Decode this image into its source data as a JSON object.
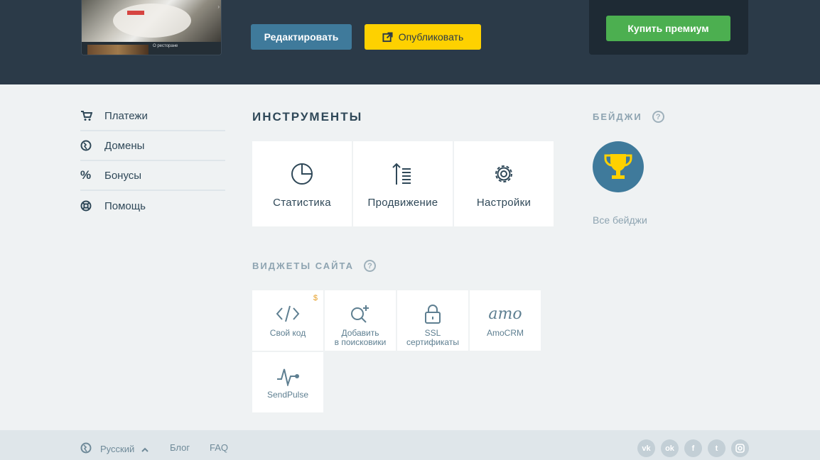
{
  "header": {
    "preview_caption": "О ресторане",
    "edit_button": "Редактировать",
    "publish_button": "Опубликовать",
    "premium_button": "Купить премиум"
  },
  "sidebar": {
    "items": [
      {
        "label": "Платежи",
        "icon": "cart-icon"
      },
      {
        "label": "Домены",
        "icon": "globe-icon"
      },
      {
        "label": "Бонусы",
        "icon": "percent-icon"
      },
      {
        "label": "Помощь",
        "icon": "lifebuoy-icon"
      }
    ]
  },
  "tools": {
    "title": "ИНСТРУМЕНТЫ",
    "items": [
      {
        "label": "Статистика",
        "icon": "pie-chart-icon"
      },
      {
        "label": "Продвижение",
        "icon": "promotion-icon"
      },
      {
        "label": "Настройки",
        "icon": "gear-icon"
      }
    ]
  },
  "widgets": {
    "title": "ВИДЖЕТЫ САЙТА",
    "help": "?",
    "items": [
      {
        "label": "Свой код",
        "icon": "code-icon",
        "paid_mark": "$"
      },
      {
        "label_line1": "Добавить",
        "label_line2": "в поисковики",
        "icon": "search-add-icon"
      },
      {
        "label_line1": "SSL",
        "label_line2": "сертификаты",
        "icon": "lock-icon"
      },
      {
        "label": "AmoCRM",
        "icon": "amo-logo",
        "logo_text": "amo"
      },
      {
        "label": "SendPulse",
        "icon": "pulse-icon"
      }
    ]
  },
  "badges": {
    "title": "БЕЙДЖИ",
    "help": "?",
    "all_link": "Все бейджи",
    "badge_icon": "trophy-icon"
  },
  "footer": {
    "language": "Русский",
    "blog": "Блог",
    "faq": "FAQ",
    "socials": [
      "vk",
      "ok",
      "f",
      "t",
      "ig"
    ]
  },
  "colors": {
    "header_bg": "#2b3a48",
    "edit_button": "#3f7a9b",
    "publish_button": "#fed100",
    "premium_button": "#4caf50",
    "accent_blue": "#3f7a9b"
  }
}
